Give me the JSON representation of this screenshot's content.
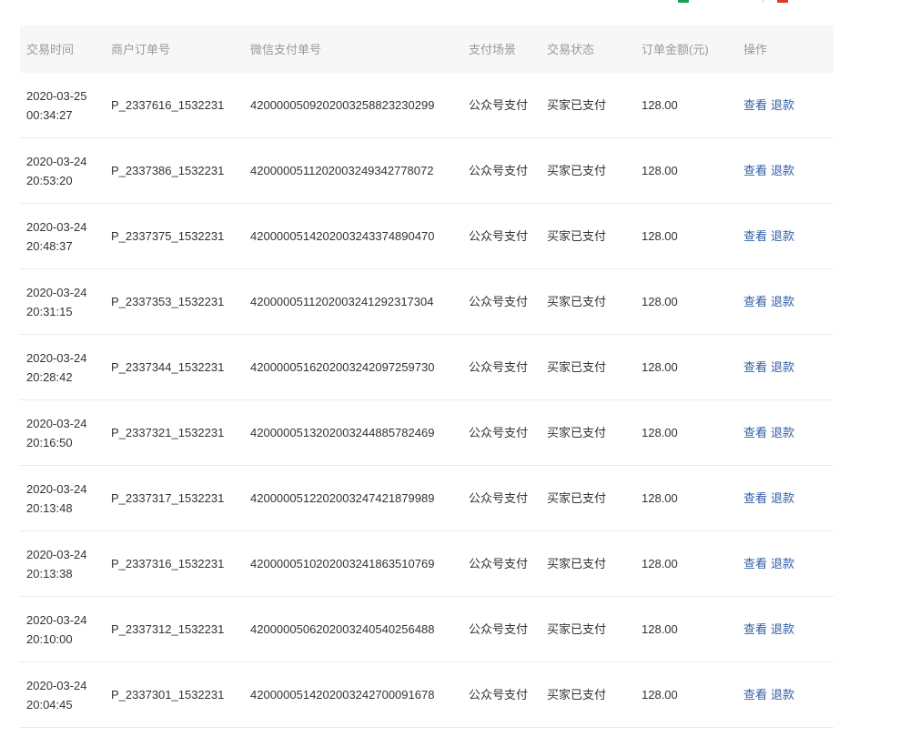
{
  "toolbar": {
    "icons": [
      {
        "name": "excel-icon",
        "color": "#1f9d55"
      },
      {
        "name": "pdf-icon",
        "color": "#e0392b"
      }
    ]
  },
  "colors": {
    "link": "#2f5ea6",
    "header_bg": "#f7f7f7",
    "header_text": "#999999",
    "text": "#333333",
    "divider": "#ebebeb"
  },
  "table": {
    "columns": [
      "交易时间",
      "商户订单号",
      "微信支付单号",
      "支付场景",
      "交易状态",
      "订单金额(元)",
      "操作"
    ],
    "rows": [
      {
        "date": "2020-03-25",
        "time": "00:34:27",
        "merchant_order_no": "P_2337616_1532231",
        "wechat_pay_no": "4200000509202003258823230299",
        "pay_scene": "公众号支付",
        "status": "买家已支付",
        "amount": "128.00",
        "actions": [
          "查看",
          "退款"
        ]
      },
      {
        "date": "2020-03-24",
        "time": "20:53:20",
        "merchant_order_no": "P_2337386_1532231",
        "wechat_pay_no": "4200000511202003249342778072",
        "pay_scene": "公众号支付",
        "status": "买家已支付",
        "amount": "128.00",
        "actions": [
          "查看",
          "退款"
        ]
      },
      {
        "date": "2020-03-24",
        "time": "20:48:37",
        "merchant_order_no": "P_2337375_1532231",
        "wechat_pay_no": "4200000514202003243374890470",
        "pay_scene": "公众号支付",
        "status": "买家已支付",
        "amount": "128.00",
        "actions": [
          "查看",
          "退款"
        ]
      },
      {
        "date": "2020-03-24",
        "time": "20:31:15",
        "merchant_order_no": "P_2337353_1532231",
        "wechat_pay_no": "4200000511202003241292317304",
        "pay_scene": "公众号支付",
        "status": "买家已支付",
        "amount": "128.00",
        "actions": [
          "查看",
          "退款"
        ]
      },
      {
        "date": "2020-03-24",
        "time": "20:28:42",
        "merchant_order_no": "P_2337344_1532231",
        "wechat_pay_no": "4200000516202003242097259730",
        "pay_scene": "公众号支付",
        "status": "买家已支付",
        "amount": "128.00",
        "actions": [
          "查看",
          "退款"
        ]
      },
      {
        "date": "2020-03-24",
        "time": "20:16:50",
        "merchant_order_no": "P_2337321_1532231",
        "wechat_pay_no": "4200000513202003244885782469",
        "pay_scene": "公众号支付",
        "status": "买家已支付",
        "amount": "128.00",
        "actions": [
          "查看",
          "退款"
        ]
      },
      {
        "date": "2020-03-24",
        "time": "20:13:48",
        "merchant_order_no": "P_2337317_1532231",
        "wechat_pay_no": "4200000512202003247421879989",
        "pay_scene": "公众号支付",
        "status": "买家已支付",
        "amount": "128.00",
        "actions": [
          "查看",
          "退款"
        ]
      },
      {
        "date": "2020-03-24",
        "time": "20:13:38",
        "merchant_order_no": "P_2337316_1532231",
        "wechat_pay_no": "4200000510202003241863510769",
        "pay_scene": "公众号支付",
        "status": "买家已支付",
        "amount": "128.00",
        "actions": [
          "查看",
          "退款"
        ]
      },
      {
        "date": "2020-03-24",
        "time": "20:10:00",
        "merchant_order_no": "P_2337312_1532231",
        "wechat_pay_no": "4200000506202003240540256488",
        "pay_scene": "公众号支付",
        "status": "买家已支付",
        "amount": "128.00",
        "actions": [
          "查看",
          "退款"
        ]
      },
      {
        "date": "2020-03-24",
        "time": "20:04:45",
        "merchant_order_no": "P_2337301_1532231",
        "wechat_pay_no": "4200000514202003242700091678",
        "pay_scene": "公众号支付",
        "status": "买家已支付",
        "amount": "128.00",
        "actions": [
          "查看",
          "退款"
        ]
      }
    ]
  }
}
